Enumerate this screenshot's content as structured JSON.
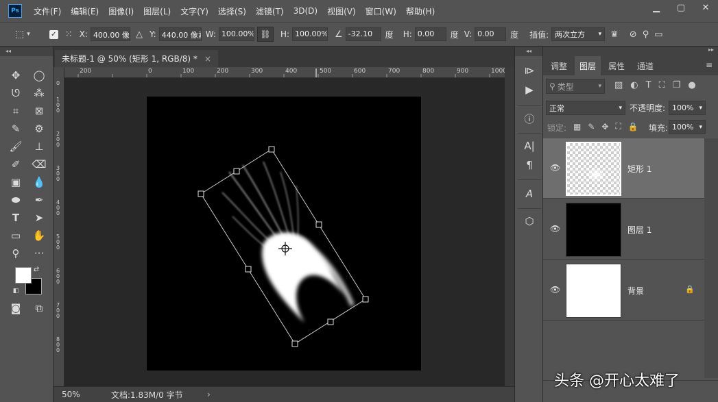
{
  "menubar": {
    "logo": "Ps",
    "items": [
      "文件(F)",
      "编辑(E)",
      "图像(I)",
      "图层(L)",
      "文字(Y)",
      "选择(S)",
      "滤镜(T)",
      "3D(D)",
      "视图(V)",
      "窗口(W)",
      "帮助(H)"
    ],
    "window_controls": [
      "minimize-icon",
      "maximize-icon",
      "close-icon"
    ]
  },
  "options": {
    "x_label": "X:",
    "x_value": "400.00 像素",
    "y_label": "Y:",
    "y_value": "440.00 像素",
    "w_label": "W:",
    "w_value": "100.00%",
    "h_label": "H:",
    "h_value": "100.00%",
    "angle_value": "-32.10",
    "angle_unit": "度",
    "hskew_label": "H:",
    "hskew_value": "0.00",
    "hskew_unit": "度",
    "vskew_label": "V:",
    "vskew_value": "0.00",
    "vskew_unit": "度",
    "interp_label": "插值:",
    "interp_value": "两次立方"
  },
  "document": {
    "tab_title": "未标题-1 @ 50% (矩形 1, RGB/8) *",
    "close_glyph": "×",
    "ruler_h": [
      "200",
      "0",
      "100",
      "200",
      "300",
      "400",
      "500",
      "600",
      "700",
      "800",
      "900",
      "1000"
    ],
    "ruler_v": [
      [
        "0"
      ],
      [
        "1",
        "0",
        "0"
      ],
      [
        "2",
        "0",
        "0"
      ],
      [
        "3",
        "0",
        "0"
      ],
      [
        "4",
        "0",
        "0"
      ],
      [
        "5",
        "0",
        "0"
      ],
      [
        "6",
        "0",
        "0"
      ],
      [
        "7",
        "0",
        "0"
      ],
      [
        "8",
        "0",
        "0"
      ]
    ],
    "zoom": "50%",
    "doc_info": "文档:1.83M/0 字节",
    "status_arrow": "›"
  },
  "layers_panel": {
    "tabs": [
      "调整",
      "图层",
      "属性",
      "通道"
    ],
    "active_tab": "图层",
    "filter_placeholder": "类型",
    "blend_mode": "正常",
    "opacity_label": "不透明度:",
    "opacity_value": "100%",
    "lock_label": "锁定:",
    "fill_label": "填充:",
    "fill_value": "100%",
    "layers": [
      {
        "name": "矩形 1",
        "selected": true
      },
      {
        "name": "图层 1",
        "selected": false
      },
      {
        "name": "背景",
        "selected": false,
        "locked": true
      }
    ]
  },
  "watermark": "头条 @开心太难了",
  "colors": {
    "foreground": "#ffffff",
    "background": "#000000",
    "ps_blue": "#31a8ff"
  }
}
